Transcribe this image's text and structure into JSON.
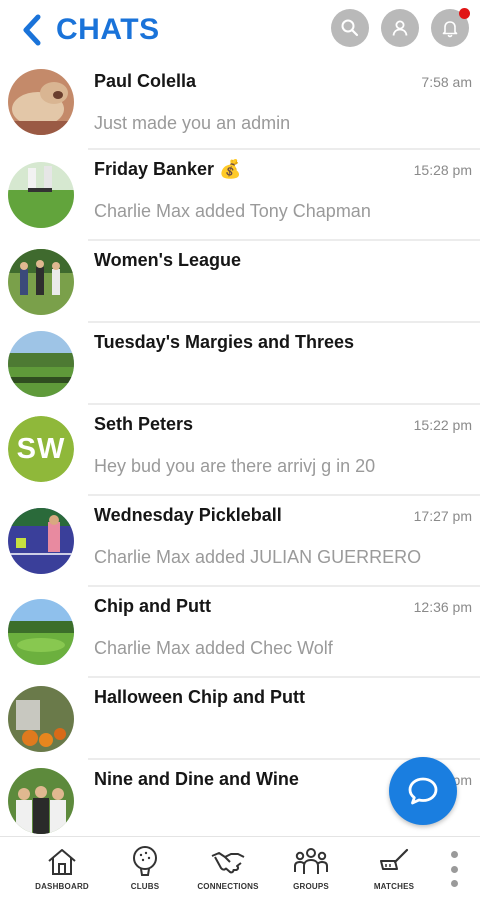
{
  "header": {
    "title": "CHATS",
    "icons": [
      "back-chevron-icon",
      "search-icon",
      "profile-icon",
      "bell-icon"
    ],
    "accent_color": "#1a73d9",
    "notification_color": "#e01515"
  },
  "chats": [
    {
      "name": "Paul Colella",
      "time": "7:58 am",
      "preview": "Just made you an admin",
      "avatar": "dog-photo"
    },
    {
      "name": "Friday Banker 💰",
      "time": "15:28 pm",
      "preview": "Charlie Max added Tony Chapman",
      "avatar": "golf-course-photo"
    },
    {
      "name": "Women's League",
      "time": "",
      "preview": "",
      "avatar": "golfers-photo"
    },
    {
      "name": "Tuesday's Margies and Threes",
      "time": "",
      "preview": "",
      "avatar": "fairway-photo"
    },
    {
      "name": "Seth Peters",
      "time": "15:22 pm",
      "preview": "Hey bud you are there arrivj g in 20",
      "avatar": "initials",
      "initials": "SW",
      "initials_color": "#8fb83a"
    },
    {
      "name": "Wednesday Pickleball",
      "time": "17:27 pm",
      "preview": "Charlie Max added JULIAN GUERRERO",
      "avatar": "pickleball-photo"
    },
    {
      "name": "Chip and Putt",
      "time": "12:36 pm",
      "preview": "Charlie Max added Chec Wolf",
      "avatar": "green-photo"
    },
    {
      "name": "Halloween Chip and Putt",
      "time": "",
      "preview": "",
      "avatar": "pumpkins-photo"
    },
    {
      "name": "Nine and Dine and Wine",
      "time": "pm",
      "preview": "",
      "avatar": "group-photo"
    }
  ],
  "fab": {
    "icon": "chat-bubble-icon",
    "color": "#1a7ee0"
  },
  "nav": [
    {
      "label": "DASHBOARD",
      "icon": "house-icon"
    },
    {
      "label": "CLUBS",
      "icon": "golf-ball-icon"
    },
    {
      "label": "CONNECTIONS",
      "icon": "handshake-icon"
    },
    {
      "label": "GROUPS",
      "icon": "people-icon"
    },
    {
      "label": "MATCHES",
      "icon": "golf-club-icon"
    }
  ]
}
